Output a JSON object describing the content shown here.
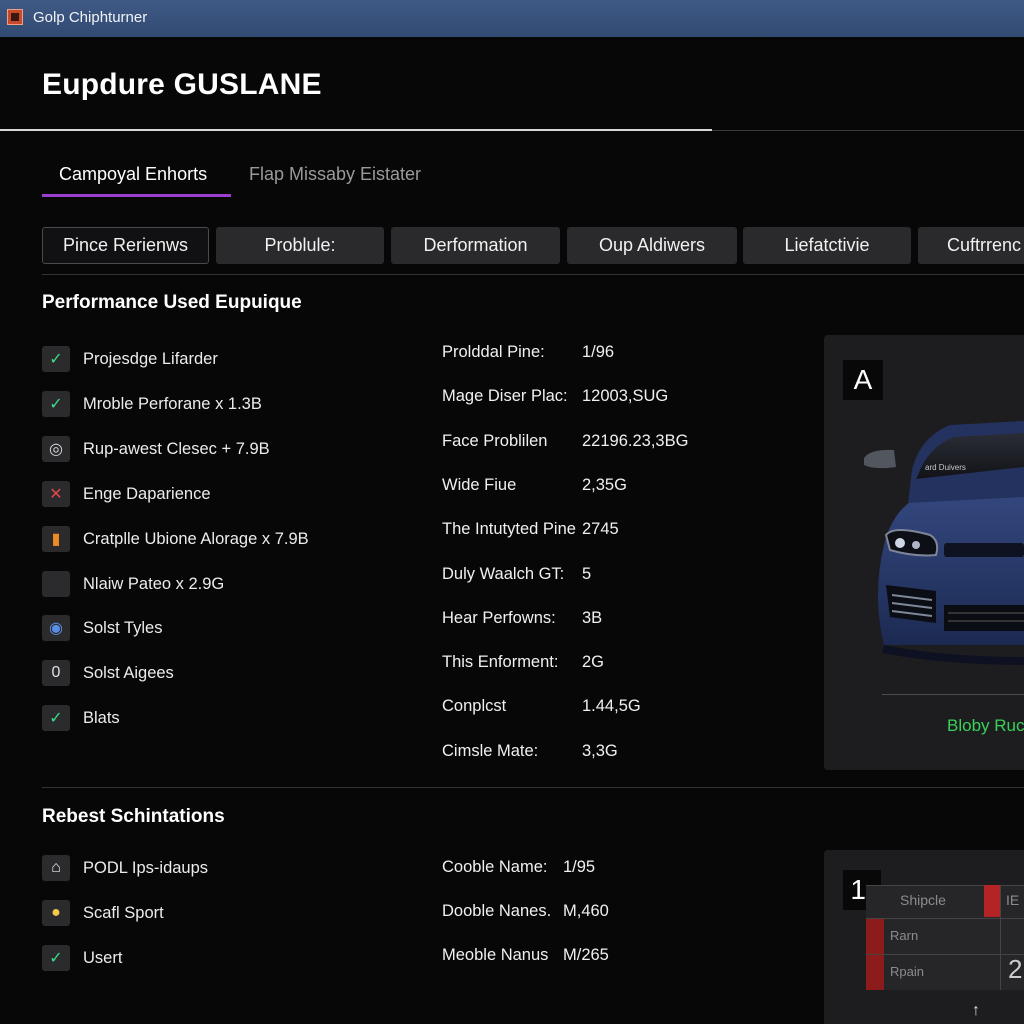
{
  "window": {
    "title": "Golp Chiphturner",
    "app_icon": "app-icon"
  },
  "page": {
    "title": "Eupdure GUSLANE"
  },
  "tabs": [
    {
      "label": "Campoyal Enhorts",
      "active": true
    },
    {
      "label": "Flap Missaby Eistater",
      "active": false
    }
  ],
  "categories": [
    {
      "label": "Pince Rerienws",
      "active": true
    },
    {
      "label": "Problule:"
    },
    {
      "label": "Derformation"
    },
    {
      "label": "Oup Aldiwers"
    },
    {
      "label": "Liefatctivie"
    },
    {
      "label": "Cuftrrenc"
    }
  ],
  "section1": {
    "title": "Performance Used Eupuique",
    "features": [
      {
        "label": "Projesdge Lifarder",
        "icon": "check-icon",
        "glyph": "✓",
        "color": "#3ddc84"
      },
      {
        "label": "Mroble Perforane x 1.3B",
        "icon": "check-icon",
        "glyph": "✓",
        "color": "#3ddc84"
      },
      {
        "label": "Rup-awest Clesec + 7.9B",
        "icon": "target-icon",
        "glyph": "◎",
        "color": "#d8d8d8"
      },
      {
        "label": "Enge Daparience",
        "icon": "cross-icon",
        "glyph": "✕",
        "color": "#e04848"
      },
      {
        "label": "Cratplle Ubione Alorage x 7.9B",
        "icon": "bar-chart-icon",
        "glyph": "▮",
        "color": "#f08a24"
      },
      {
        "label": "Nlaiw Pateo x 2.9G",
        "icon": "blank-icon",
        "glyph": "",
        "color": "#888"
      },
      {
        "label": "Solst Tyles",
        "icon": "globe-icon",
        "glyph": "◉",
        "color": "#5b8fe6"
      },
      {
        "label": "Solst Aigees",
        "icon": "zero-icon",
        "glyph": "0",
        "color": "#e0e0e0"
      },
      {
        "label": "Blats",
        "icon": "check-icon",
        "glyph": "✓",
        "color": "#3ddc84"
      }
    ],
    "specs": [
      {
        "key": "Prolddal Pine:",
        "value": "1/96"
      },
      {
        "key": "Mage Diser Plac:",
        "value": "12003,SUG"
      },
      {
        "key": "Face Problilen",
        "value": "22196.23,3BG"
      },
      {
        "key": "Wide Fiue",
        "value": "2,35G"
      },
      {
        "key": "The Intutyted Pine",
        "value": "2745"
      },
      {
        "key": "Duly Waalch GT:",
        "value": "5"
      },
      {
        "key": "Hear Perfowns:",
        "value": "3B"
      },
      {
        "key": "This Enforment:",
        "value": "2G"
      },
      {
        "key": "Conplcst",
        "value": "1.44,5G"
      },
      {
        "key": "Cimsle Mate:",
        "value": "3,3G"
      }
    ],
    "car_panel": {
      "badge": "A",
      "caption": "Bloby Ruc",
      "caption_color": "#39d15a",
      "windshield_text": "ard Duivers"
    }
  },
  "section2": {
    "title": "Rebest Schintations",
    "features": [
      {
        "label": "PODL Ips-idaups",
        "icon": "lock-icon",
        "glyph": "⌂",
        "color": "#e8e8e8"
      },
      {
        "label": "Scafl Sport",
        "icon": "badge-icon",
        "glyph": "●",
        "color": "#f2c94c"
      },
      {
        "label": "Usert",
        "icon": "check-icon",
        "glyph": "✓",
        "color": "#3ddc84"
      }
    ],
    "specs": [
      {
        "key": "Cooble Name:",
        "value": "1/95"
      },
      {
        "key": "Dooble Nanes.",
        "value": "M,460"
      },
      {
        "key": "Meoble Nanus",
        "value": "M/265"
      }
    ],
    "panel": {
      "badge": "1.",
      "header": "Shipcle",
      "header2": "IE",
      "row1": "Rarn",
      "row2": "Rpain",
      "big": "2",
      "arrow": "↑"
    }
  },
  "colors": {
    "accent": "#9b3fd3",
    "success": "#3ddc84",
    "danger": "#e04848",
    "titlebar": "#3f5a86"
  }
}
